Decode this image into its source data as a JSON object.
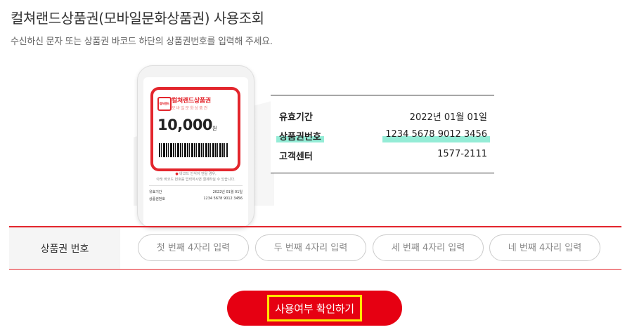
{
  "page": {
    "title": "컬쳐랜드상품권(모바일문화상품권) 사용조회",
    "subtitle": "수신하신 문자 또는 상품권 바코드 하단의 상품권번호를 입력해 주세요."
  },
  "illustration": {
    "card": {
      "logo_text": "컬쳐랜드",
      "name": "컬쳐랜드상품권",
      "subname": "모바일문화상품권",
      "amount": "10,000",
      "currency": "원"
    },
    "notice_line1": "바코드 인식이 안될 경우,",
    "notice_line2": "아래 바코드 번호를 입력하시면 결제하실 수 있습니다.",
    "mini_rows": [
      {
        "label": "유효기간",
        "value": "2022년 01월 01일"
      },
      {
        "label": "상품권번호",
        "value": "1234 5678 9012 3456"
      }
    ],
    "info": [
      {
        "label": "유효기간",
        "value": "2022년 01월 01일"
      },
      {
        "label": "상품권번호",
        "value": "1234  5678  9012  3456"
      },
      {
        "label": "고객센터",
        "value": "1577-2111"
      }
    ],
    "highlight_color": "#3cdcb4",
    "brand_color": "#e3262d"
  },
  "form": {
    "label": "상품권 번호",
    "inputs": [
      {
        "placeholder": "첫 번째 4자리 입력",
        "value": ""
      },
      {
        "placeholder": "두 번째 4자리 입력",
        "value": ""
      },
      {
        "placeholder": "세 번째 4자리 입력",
        "value": ""
      },
      {
        "placeholder": "네 번째 4자리 입력",
        "value": ""
      }
    ]
  },
  "submit": {
    "label": "사용여부 확인하기",
    "button_color": "#e60012",
    "outline_color": "#ffe600"
  }
}
